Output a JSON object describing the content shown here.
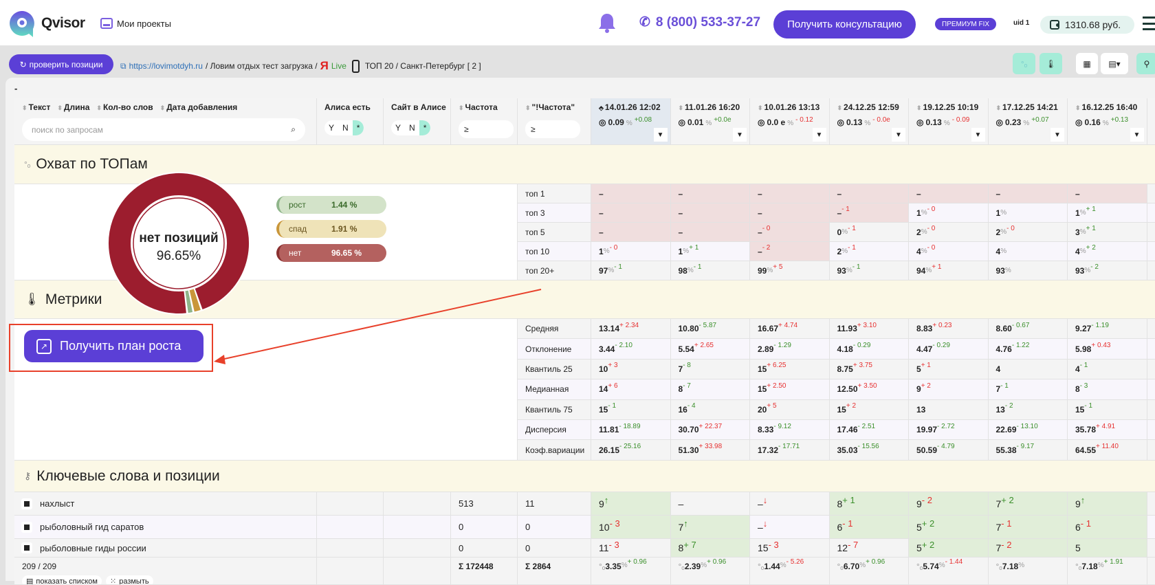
{
  "header": {
    "brand": "Qvisor",
    "my_projects": "Мои проекты",
    "phone": "8 (800) 533-37-27",
    "consult_button": "Получить консультацию",
    "plan_badge": "ПРЕМИУМ FIX",
    "uid": "uid 1",
    "balance": "1310.68 руб."
  },
  "toolbar": {
    "check_button": "проверить позиции",
    "site_link": "https://lovimotdyh.ru",
    "project": "/ Ловим отдых тест загрузка /",
    "engine_live": "Live",
    "region": "ТОП 20 / Санкт-Петербург [ 2 ]",
    "collapse": "-"
  },
  "colors": {
    "accent": "#5b3fd6",
    "teal": "#a5ecd8",
    "growth": "#8fb58a",
    "fall": "#c9963a",
    "none": "#9c1d2e"
  },
  "columns": {
    "text": "Текст",
    "length": "Длина",
    "words": "Кол-во слов",
    "date_added": "Дата добавления",
    "search_placeholder": "поиск по запросам",
    "alisa": "Алиса есть",
    "site_alisa": "Сайт в Алисе",
    "yn": [
      "Y",
      "N",
      "*"
    ],
    "freq": "Частота",
    "freq_exact": "\"!Частота\"",
    "ge": "≥"
  },
  "dates": [
    {
      "date": "14.01.26 12:02",
      "vis": "0.09",
      "delta": "+0.08",
      "c": "g"
    },
    {
      "date": "11.01.26 16:20",
      "vis": "0.01",
      "delta": "+0.0e",
      "c": "g"
    },
    {
      "date": "10.01.26 13:13",
      "vis": "0.0 e",
      "delta": "- 0.12",
      "c": "r"
    },
    {
      "date": "24.12.25 12:59",
      "vis": "0.13",
      "delta": "- 0.0e",
      "c": "r"
    },
    {
      "date": "19.12.25 10:19",
      "vis": "0.13",
      "delta": "- 0.09",
      "c": "r"
    },
    {
      "date": "17.12.25 14:21",
      "vis": "0.23",
      "delta": "+0.07",
      "c": "g"
    },
    {
      "date": "16.12.25 16:40",
      "vis": "0.16",
      "delta": "+0.13",
      "c": "g"
    }
  ],
  "coverage": {
    "title": "Охват по ТОПам",
    "chart_data": {
      "type": "pie",
      "center_label": "нет позиций",
      "center_value": "96.65%",
      "slices": [
        {
          "label": "рост",
          "value": 1.44,
          "text": "1.44 %"
        },
        {
          "label": "спад",
          "value": 1.91,
          "text": "1.91 %"
        },
        {
          "label": "нет",
          "value": 96.65,
          "text": "96.65 %"
        }
      ]
    },
    "rows": [
      {
        "label": "топ 1",
        "cells": [
          [
            "–"
          ],
          [
            "–"
          ],
          [
            "–"
          ],
          [
            "–"
          ],
          [
            "–"
          ],
          [
            "–"
          ],
          [
            "–"
          ]
        ]
      },
      {
        "label": "топ 3",
        "cells": [
          [
            "–"
          ],
          [
            "–"
          ],
          [
            "–"
          ],
          [
            "–",
            "- 1",
            "r"
          ],
          [
            "1",
            "- 0",
            "r"
          ],
          [
            "1"
          ],
          [
            "1",
            "+ 1",
            "g"
          ]
        ]
      },
      {
        "label": "топ 5",
        "cells": [
          [
            "–"
          ],
          [
            "–"
          ],
          [
            "–",
            "- 0",
            "r"
          ],
          [
            "0",
            "- 1",
            "r"
          ],
          [
            "2",
            "- 0",
            "r"
          ],
          [
            "2",
            "- 0",
            "r"
          ],
          [
            "3",
            "+ 1",
            "g"
          ]
        ]
      },
      {
        "label": "топ 10",
        "cells": [
          [
            "1",
            "- 0",
            "r"
          ],
          [
            "1",
            "+ 1",
            "g"
          ],
          [
            "–",
            "- 2",
            "r"
          ],
          [
            "2",
            "- 1",
            "r"
          ],
          [
            "4",
            "- 0",
            "r"
          ],
          [
            "4"
          ],
          [
            "4",
            "+ 2",
            "g"
          ]
        ]
      },
      {
        "label": "топ 20+",
        "cells": [
          [
            "97",
            "- 1",
            "g"
          ],
          [
            "98",
            "- 1",
            "g"
          ],
          [
            "99",
            "+ 5",
            "r"
          ],
          [
            "93",
            "- 1",
            "g"
          ],
          [
            "94",
            "+ 1",
            "r"
          ],
          [
            "93"
          ],
          [
            "93",
            "- 2",
            "g"
          ]
        ]
      }
    ]
  },
  "metrics": {
    "title": "Метрики",
    "plan_button": "Получить план роста",
    "rows": [
      {
        "label": "Средняя",
        "cells": [
          [
            "13.14",
            "+ 2.34",
            "r"
          ],
          [
            "10.80",
            "- 5.87",
            "g"
          ],
          [
            "16.67",
            "+ 4.74",
            "r"
          ],
          [
            "11.93",
            "+ 3.10",
            "r"
          ],
          [
            "8.83",
            "+ 0.23",
            "r"
          ],
          [
            "8.60",
            "- 0.67",
            "g"
          ],
          [
            "9.27",
            "- 1.19",
            "g"
          ]
        ]
      },
      {
        "label": "Отклонение",
        "cells": [
          [
            "3.44",
            "- 2.10",
            "g"
          ],
          [
            "5.54",
            "+ 2.65",
            "r"
          ],
          [
            "2.89",
            "- 1.29",
            "g"
          ],
          [
            "4.18",
            "- 0.29",
            "g"
          ],
          [
            "4.47",
            "- 0.29",
            "g"
          ],
          [
            "4.76",
            "- 1.22",
            "g"
          ],
          [
            "5.98",
            "+ 0.43",
            "r"
          ]
        ]
      },
      {
        "label": "Квантиль 25",
        "cells": [
          [
            "10",
            "+ 3",
            "r"
          ],
          [
            "7",
            "- 8",
            "g"
          ],
          [
            "15",
            "+ 6.25",
            "r"
          ],
          [
            "8.75",
            "+ 3.75",
            "r"
          ],
          [
            "5",
            "+ 1",
            "r"
          ],
          [
            "4"
          ],
          [
            "4",
            "- 1",
            "g"
          ]
        ]
      },
      {
        "label": "Медианная",
        "cells": [
          [
            "14",
            "+ 6",
            "r"
          ],
          [
            "8",
            "- 7",
            "g"
          ],
          [
            "15",
            "+ 2.50",
            "r"
          ],
          [
            "12.50",
            "+ 3.50",
            "r"
          ],
          [
            "9",
            "+ 2",
            "r"
          ],
          [
            "7",
            "- 1",
            "g"
          ],
          [
            "8",
            "- 3",
            "g"
          ]
        ]
      },
      {
        "label": "Квантиль 75",
        "cells": [
          [
            "15",
            "- 1",
            "g"
          ],
          [
            "16",
            "- 4",
            "g"
          ],
          [
            "20",
            "+ 5",
            "r"
          ],
          [
            "15",
            "+ 2",
            "r"
          ],
          [
            "13"
          ],
          [
            "13",
            "- 2",
            "g"
          ],
          [
            "15",
            "- 1",
            "g"
          ]
        ]
      },
      {
        "label": "Дисперсия",
        "cells": [
          [
            "11.81",
            "- 18.89",
            "g"
          ],
          [
            "30.70",
            "+ 22.37",
            "r"
          ],
          [
            "8.33",
            "- 9.12",
            "g"
          ],
          [
            "17.46",
            "- 2.51",
            "g"
          ],
          [
            "19.97",
            "- 2.72",
            "g"
          ],
          [
            "22.69",
            "- 13.10",
            "g"
          ],
          [
            "35.78",
            "+ 4.91",
            "r"
          ]
        ]
      },
      {
        "label": "Коэф.вариации",
        "cells": [
          [
            "26.15",
            "- 25.16",
            "g"
          ],
          [
            "51.30",
            "+ 33.98",
            "r"
          ],
          [
            "17.32",
            "- 17.71",
            "g"
          ],
          [
            "35.03",
            "- 15.56",
            "g"
          ],
          [
            "50.59",
            "- 4.79",
            "g"
          ],
          [
            "55.38",
            "- 9.17",
            "g"
          ],
          [
            "64.55",
            "+ 11.40",
            "r"
          ]
        ]
      }
    ]
  },
  "keywords": {
    "title": "Ключевые слова и позиции",
    "rows": [
      {
        "text": "нахлыст",
        "freq": "513",
        "freq_exact": "11",
        "cells": [
          [
            "9",
            "↑",
            "g"
          ],
          [
            "–"
          ],
          [
            "–",
            "↓",
            "r"
          ],
          [
            "8",
            "+ 1",
            "g"
          ],
          [
            "9",
            "- 2",
            "r"
          ],
          [
            "7",
            "+ 2",
            "g"
          ],
          [
            "9",
            "↑",
            "g"
          ]
        ]
      },
      {
        "text": "рыболовный гид саратов",
        "freq": "0",
        "freq_exact": "0",
        "cells": [
          [
            "10",
            "- 3",
            "r"
          ],
          [
            "7",
            "↑",
            "g"
          ],
          [
            "–",
            "↓",
            "r"
          ],
          [
            "6",
            "- 1",
            "r"
          ],
          [
            "5",
            "+ 2",
            "g"
          ],
          [
            "7",
            "- 1",
            "r"
          ],
          [
            "6",
            "- 1",
            "r"
          ]
        ]
      },
      {
        "text": "рыболовные гиды россии",
        "freq": "0",
        "freq_exact": "0",
        "cells": [
          [
            "11",
            "- 3",
            "r"
          ],
          [
            "8",
            "+ 7",
            "g"
          ],
          [
            "15",
            "- 3",
            "r"
          ],
          [
            "12",
            "- 7",
            "r"
          ],
          [
            "5",
            "+ 2",
            "g"
          ],
          [
            "7",
            "- 2",
            "r"
          ],
          [
            "5"
          ]
        ]
      }
    ]
  },
  "footer": {
    "count": "209 / 209",
    "list_button": "показать списком",
    "blur_button": "размыть",
    "freq_sum": "Σ 172448",
    "freq_exact_sum": "Σ 2864",
    "cells": [
      [
        "3.35",
        "+ 0.96",
        "g"
      ],
      [
        "2.39",
        "+ 0.96",
        "g"
      ],
      [
        "1.44",
        "- 5.26",
        "r"
      ],
      [
        "6.70",
        "+ 0.96",
        "g"
      ],
      [
        "5.74",
        "- 1.44",
        "r"
      ],
      [
        "7.18"
      ],
      [
        "7.18",
        "+ 1.91",
        "g"
      ]
    ]
  }
}
